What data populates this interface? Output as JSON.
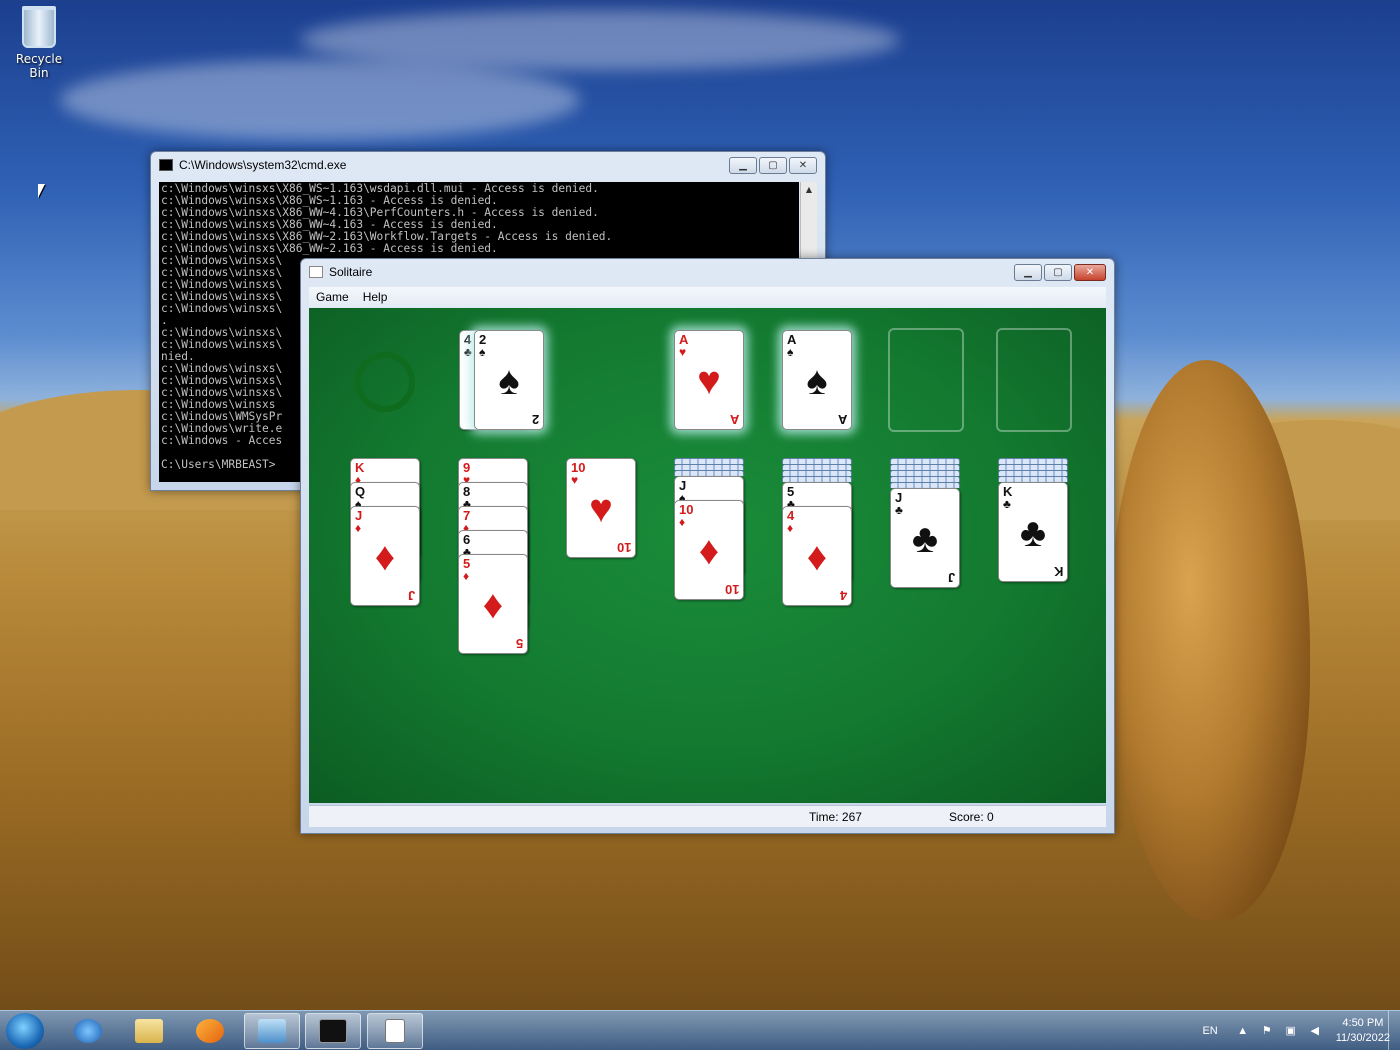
{
  "desktop": {
    "recycle_bin": "Recycle Bin"
  },
  "cmd": {
    "title": "C:\\Windows\\system32\\cmd.exe",
    "lines": [
      "c:\\Windows\\winsxs\\X86_WS~1.163\\wsdapi.dll.mui - Access is denied.",
      "c:\\Windows\\winsxs\\X86_WS~1.163 - Access is denied.",
      "c:\\Windows\\winsxs\\X86_WW~4.163\\PerfCounters.h - Access is denied.",
      "c:\\Windows\\winsxs\\X86_WW~4.163 - Access is denied.",
      "c:\\Windows\\winsxs\\X86_WW~2.163\\Workflow.Targets - Access is denied.",
      "c:\\Windows\\winsxs\\X86_WW~2.163 - Access is denied.",
      "c:\\Windows\\winsxs\\",
      "c:\\Windows\\winsxs\\",
      "c:\\Windows\\winsxs\\",
      "c:\\Windows\\winsxs\\",
      "c:\\Windows\\winsxs\\",
      ".",
      "c:\\Windows\\winsxs\\",
      "c:\\Windows\\winsxs\\",
      "nied.",
      "c:\\Windows\\winsxs\\",
      "c:\\Windows\\winsxs\\",
      "c:\\Windows\\winsxs\\",
      "c:\\Windows\\winsxs",
      "c:\\Windows\\WMSysPr",
      "c:\\Windows\\write.e",
      "c:\\Windows - Acces",
      "",
      "C:\\Users\\MRBEAST>"
    ]
  },
  "solitaire": {
    "title": "Solitaire",
    "menu": [
      "Game",
      "Help"
    ],
    "time_label": "Time:",
    "time_value": "267",
    "score_label": "Score:",
    "score_value": "0",
    "waste": [
      {
        "rank": "4",
        "suit": "♣",
        "color": "blk"
      },
      {
        "rank": "2",
        "suit": "♠",
        "color": "blk"
      }
    ],
    "foundations": [
      {
        "rank": "A",
        "suit": "♥",
        "color": "red"
      },
      {
        "rank": "A",
        "suit": "♠",
        "color": "blk"
      },
      {
        "rank": "",
        "suit": "",
        "color": ""
      },
      {
        "rank": "",
        "suit": "",
        "color": ""
      }
    ],
    "tableau": [
      {
        "hidden": 0,
        "cards": [
          {
            "rank": "K",
            "suit": "♦",
            "color": "red"
          },
          {
            "rank": "Q",
            "suit": "♠",
            "color": "blk"
          },
          {
            "rank": "J",
            "suit": "♦",
            "color": "red"
          }
        ]
      },
      {
        "hidden": 0,
        "cards": [
          {
            "rank": "9",
            "suit": "♥",
            "color": "red"
          },
          {
            "rank": "8",
            "suit": "♣",
            "color": "blk"
          },
          {
            "rank": "7",
            "suit": "♦",
            "color": "red"
          },
          {
            "rank": "6",
            "suit": "♣",
            "color": "blk"
          },
          {
            "rank": "5",
            "suit": "♦",
            "color": "red"
          }
        ]
      },
      {
        "hidden": 0,
        "cards": [
          {
            "rank": "10",
            "suit": "♥",
            "color": "red"
          }
        ]
      },
      {
        "hidden": 3,
        "cards": [
          {
            "rank": "J",
            "suit": "♠",
            "color": "blk"
          },
          {
            "rank": "10",
            "suit": "♦",
            "color": "red"
          }
        ]
      },
      {
        "hidden": 4,
        "cards": [
          {
            "rank": "5",
            "suit": "♣",
            "color": "blk"
          },
          {
            "rank": "4",
            "suit": "♦",
            "color": "red"
          }
        ]
      },
      {
        "hidden": 5,
        "cards": [
          {
            "rank": "J",
            "suit": "♣",
            "color": "blk"
          }
        ]
      },
      {
        "hidden": 4,
        "cards": [
          {
            "rank": "K",
            "suit": "♣",
            "color": "blk"
          }
        ]
      }
    ]
  },
  "taskbar": {
    "items": [
      "start-orb",
      "internet-explorer-icon",
      "windows-explorer-icon",
      "media-player-icon",
      "control-panel-icon",
      "cmd-icon",
      "solitaire-icon"
    ],
    "lang": "EN",
    "time": "4:50 PM",
    "date": "11/30/2022"
  }
}
